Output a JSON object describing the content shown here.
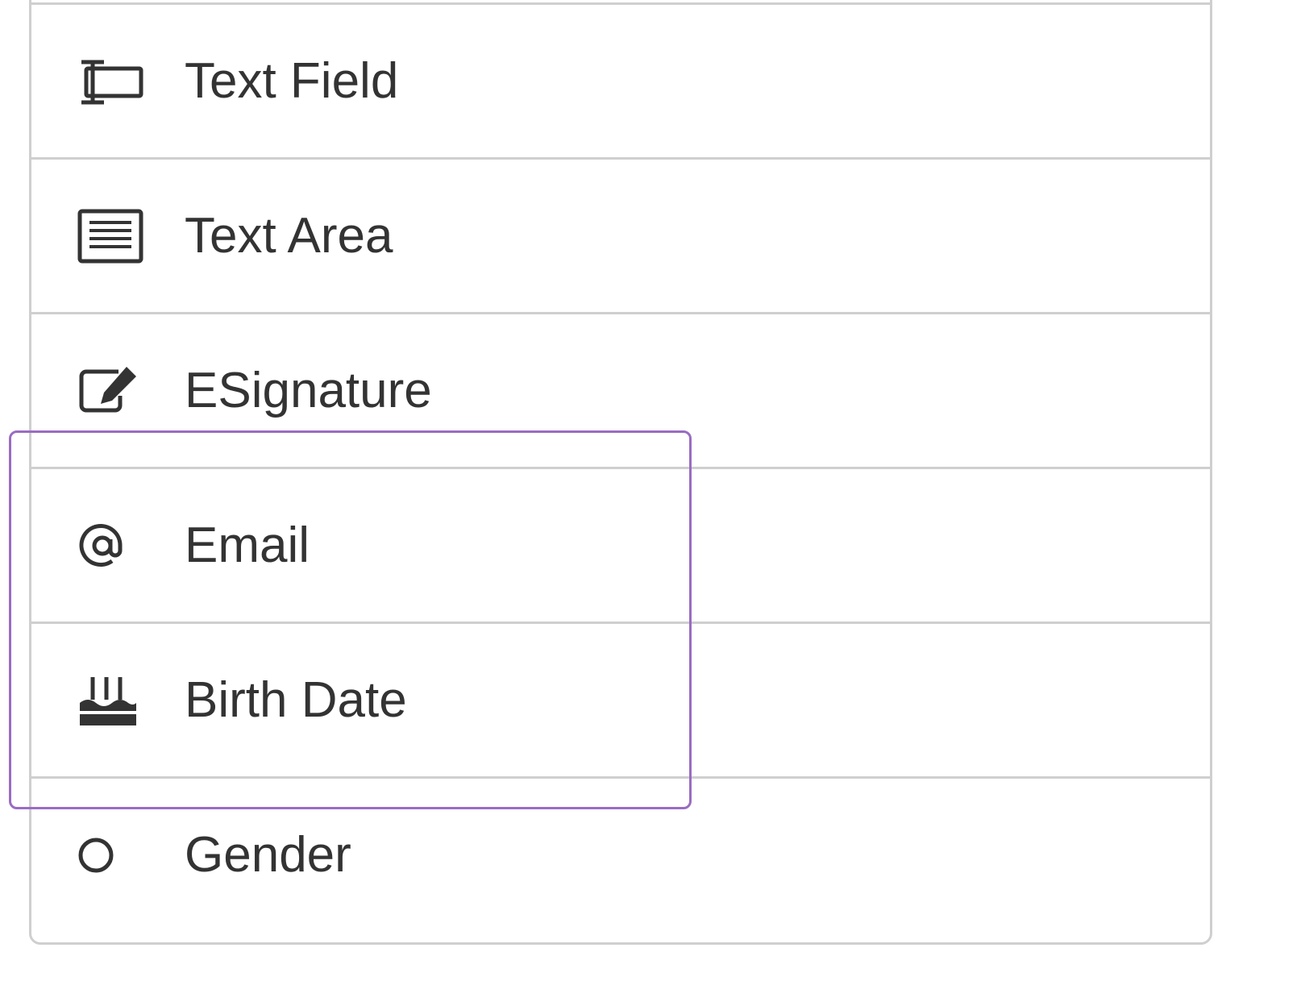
{
  "field_list": {
    "items": [
      {
        "label": "Text Field",
        "icon": "text-field-icon"
      },
      {
        "label": "Text Area",
        "icon": "text-area-icon"
      },
      {
        "label": "ESignature",
        "icon": "esignature-icon"
      },
      {
        "label": "Email",
        "icon": "at-sign-icon"
      },
      {
        "label": "Birth Date",
        "icon": "birthday-cake-icon"
      },
      {
        "label": "Gender",
        "icon": "radio-circle-icon"
      }
    ]
  },
  "colors": {
    "text": "#333333",
    "border": "#cfcfcf",
    "highlight": "#9a6cc2"
  }
}
